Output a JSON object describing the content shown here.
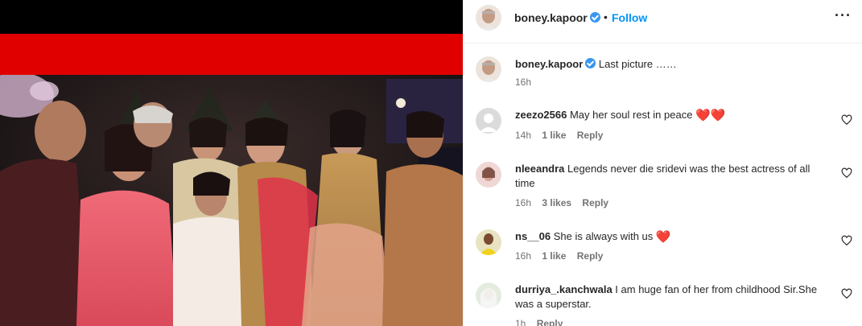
{
  "post": {
    "username": "boney.kapoor",
    "separator": "•",
    "follow_label": "Follow",
    "more_label": "···"
  },
  "caption": {
    "username": "boney.kapoor",
    "text": "Last picture ……",
    "time": "16h"
  },
  "comments": [
    {
      "username": "zeezo2566",
      "text": "May her soul rest in peace",
      "emoji": "❤️❤️",
      "time": "14h",
      "likes": "1 like",
      "reply": "Reply"
    },
    {
      "username": "nleeandra",
      "text": "Legends never die sridevi was the best actress of all time",
      "emoji": "",
      "time": "16h",
      "likes": "3 likes",
      "reply": "Reply"
    },
    {
      "username": "ns__06",
      "text": "She is always with us",
      "emoji": "❤️",
      "time": "16h",
      "likes": "1 like",
      "reply": "Reply"
    },
    {
      "username": "durriya_.kanchwala",
      "text": "I am huge fan of her from childhood Sir.She was a superstar.",
      "emoji": "",
      "time": "1h",
      "likes": "",
      "reply": "Reply"
    }
  ],
  "colors": {
    "link": "#0095f6",
    "verified": "#3897f0",
    "media_red": "#e00000",
    "muted": "#737373"
  }
}
